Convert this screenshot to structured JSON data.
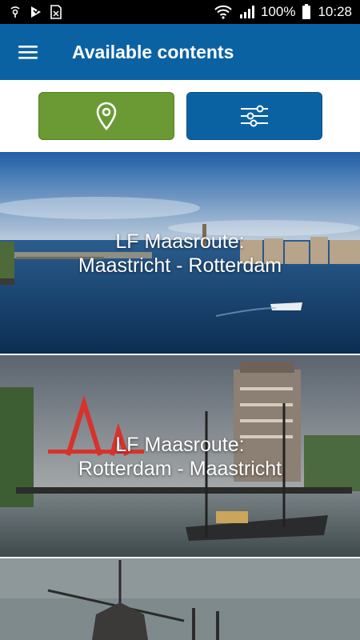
{
  "status_bar": {
    "battery": "100%",
    "time": "10:28"
  },
  "app_bar": {
    "title": "Available contents",
    "menu_icon": "hamburger-menu-icon"
  },
  "filters": {
    "location_icon": "location-pin-icon",
    "settings_icon": "sliders-icon",
    "colors": {
      "location": "#6b9a34",
      "settings": "#0b62a3"
    }
  },
  "contents": [
    {
      "title_line1": "LF Maasroute:",
      "title_line2": "Maastricht - Rotterdam"
    },
    {
      "title_line1": "LF Maasroute:",
      "title_line2": "Rotterdam - Maastricht"
    },
    {
      "title_line1": "",
      "title_line2": ""
    }
  ]
}
